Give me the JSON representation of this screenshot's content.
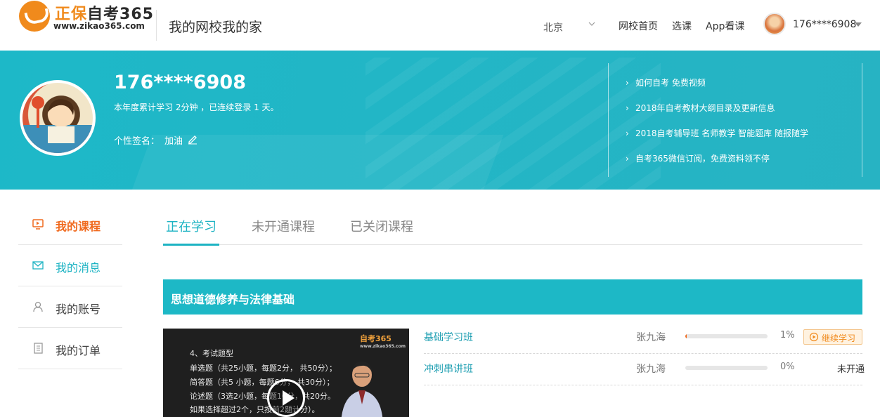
{
  "header": {
    "logo_text_orange": "正保",
    "logo_text_dark": "自考365",
    "logo_url": "www.zikao365.com",
    "site_title": "我的网校我的家",
    "city": "北京",
    "nav": [
      "网校首页",
      "选课",
      "App看课"
    ],
    "username": "176****6908"
  },
  "profile": {
    "name": "176****6908",
    "stats": "本年度累计学习 2分钟 ，已连续登录 1 天。",
    "signature_label": "个性签名：",
    "signature_value": "加油"
  },
  "banner_links": [
    "如何自考 免费视频",
    "2018年自考教材大纲目录及更新信息",
    "2018自考辅导班 名师教学 智能题库 随报随学",
    "自考365微信订阅，免费资料领不停"
  ],
  "sidebar": {
    "items": [
      {
        "label": "我的课程",
        "icon": "play-screen-icon"
      },
      {
        "label": "我的消息",
        "icon": "envelope-icon"
      },
      {
        "label": "我的账号",
        "icon": "user-icon"
      },
      {
        "label": "我的订单",
        "icon": "document-icon"
      }
    ]
  },
  "tabs": [
    "正在学习",
    "未开通课程",
    "已关闭课程"
  ],
  "course": {
    "title": "思想道德修养与法律基础",
    "video": {
      "logo": "自考365",
      "logo_url": "www.zikao365.com",
      "lines": [
        "4、考试题型",
        "单选题（共25小题，每题2分， 共50分）；",
        "简答题（共5 小题，每题6分， 共30分）；",
        "论述题（3选2小题，每题10分，共20分。",
        "如果选择超过2个，只按前2题计分）。"
      ]
    },
    "classes": [
      {
        "name": "基础学习班",
        "teacher": "张九海",
        "progress": 0.01,
        "progress_text": "1%",
        "action": "继续学习"
      },
      {
        "name": "冲刺串讲班",
        "teacher": "张九海",
        "progress": 0.0,
        "progress_text": "0%",
        "status": "未开通"
      }
    ]
  },
  "colors": {
    "accent": "#1db3c3",
    "orange": "#f06a1e"
  }
}
